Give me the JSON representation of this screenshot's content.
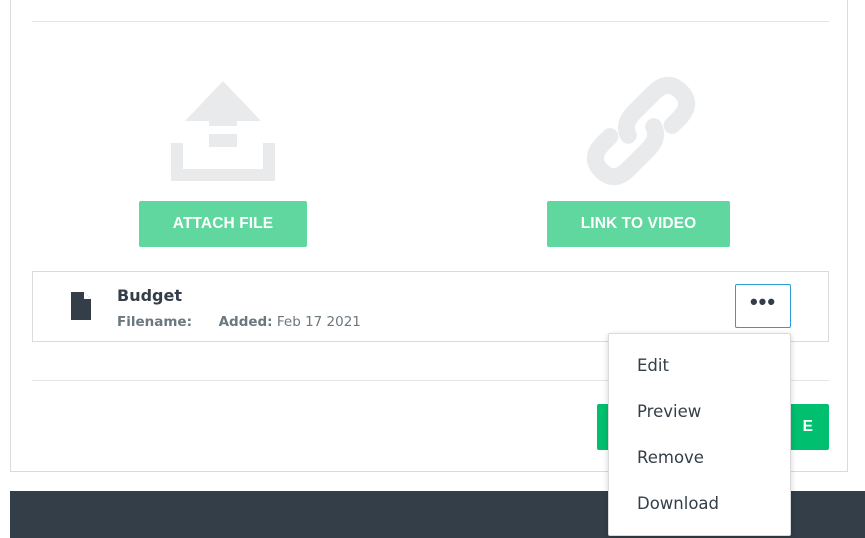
{
  "attachments": {
    "attach_button": "ATTACH FILE",
    "link_button": "LINK TO VIDEO",
    "attach_icon": "upload-icon",
    "link_icon": "link-icon"
  },
  "file": {
    "title": "Budget",
    "filename_label": "Filename:",
    "filename_value": "",
    "added_label": "Added:",
    "added_value": "Feb 17 2021",
    "icon": "document-icon",
    "more_label": "•••"
  },
  "menu": {
    "items": [
      "Edit",
      "Preview",
      "Remove",
      "Download"
    ]
  },
  "save_button": {
    "visible_text": "E"
  },
  "colors": {
    "action_green": "#5fd79e",
    "save_green": "#00bf6f",
    "focus_blue": "#2d9cd5",
    "footer_dark": "#333e48"
  }
}
